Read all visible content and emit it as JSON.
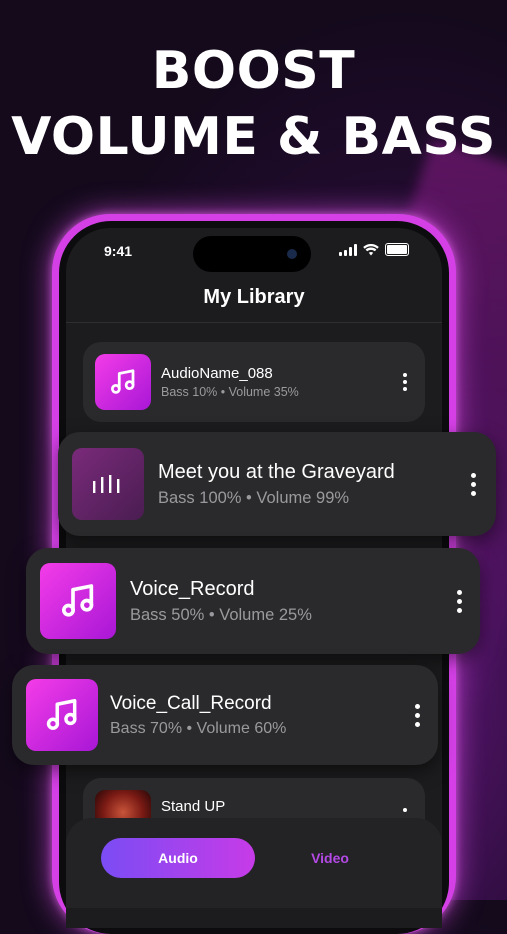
{
  "headline": {
    "line1": "BOOST",
    "line2": "VOLUME & BASS"
  },
  "status_bar": {
    "time": "9:41"
  },
  "library": {
    "title": "My Library"
  },
  "tracks": [
    {
      "name": "AudioName_088",
      "meta": "Bass 10% • Volume 35%",
      "icon": "music-note-icon"
    },
    {
      "name": "Meet you at the Graveyard",
      "meta": "Bass 100% • Volume 99%",
      "icon": "equalizer-bars-icon"
    },
    {
      "name": "Voice_Record",
      "meta": "Bass 50% • Volume 25%",
      "icon": "music-note-icon"
    },
    {
      "name": "Voice_Call_Record",
      "meta": "Bass 70% • Volume 60%",
      "icon": "music-note-icon"
    },
    {
      "name": "Stand UP",
      "meta": "",
      "icon": "album-cover-image"
    }
  ],
  "tabs": {
    "audio": "Audio",
    "video": "Video"
  },
  "colors": {
    "accent_start": "#f43ce8",
    "accent_end": "#a817d6",
    "phone_frame": "#d440e6",
    "video_tab": "#b449e6"
  }
}
